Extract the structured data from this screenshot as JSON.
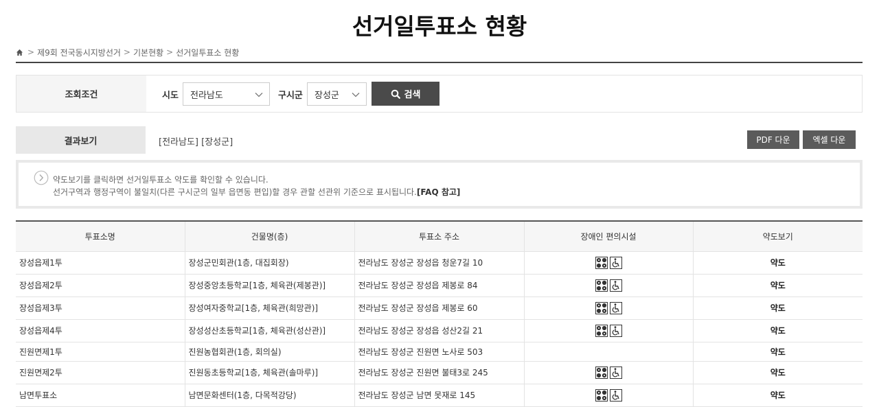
{
  "page_title": "선거일투표소 현황",
  "breadcrumb": {
    "home_icon": "home-icon",
    "items": [
      "제9회 전국동시지방선거",
      "기본현황",
      "선거일투표소 현황"
    ],
    "separator": ">"
  },
  "search": {
    "condition_label": "조회조건",
    "sido_label": "시도",
    "sido_value": "전라남도",
    "sigungu_label": "구시군",
    "sigungu_value": "장성군",
    "button_label": "검색"
  },
  "result": {
    "label": "결과보기",
    "text": "[전라남도] [장성군]",
    "pdf_button": "PDF 다운",
    "excel_button": "엑셀 다운"
  },
  "notice": {
    "line1": "약도보기를 클릭하면 선거일투표소 약도를 확인할 수 있습니다.",
    "line2": "선거구역과 행정구역이 불일치(다른 구시군의 일부 읍면동 편입)할 경우 관할 선관위 기준으로 표시됩니다.",
    "faq_link": "[FAQ 참고]"
  },
  "table": {
    "headers": [
      "투표소명",
      "건물명(층)",
      "투표소 주소",
      "장애인 편의시설",
      "약도보기"
    ],
    "rows": [
      {
        "name": "장성읍제1투",
        "building": "장성군민회관(1층, 대집회장)",
        "address": "전라남도 장성군 장성읍 청운7길 10",
        "facility": true,
        "map": "약도"
      },
      {
        "name": "장성읍제2투",
        "building": "장성중앙초등학교[1층, 체육관(제봉관)]",
        "address": "전라남도 장성군 장성읍 제봉로 84",
        "facility": true,
        "map": "약도"
      },
      {
        "name": "장성읍제3투",
        "building": "장성여자중학교[1층, 체육관(희망관)]",
        "address": "전라남도 장성군 장성읍 제봉로 60",
        "facility": true,
        "map": "약도"
      },
      {
        "name": "장성읍제4투",
        "building": "장성성산초등학교[1층, 체육관(성산관)]",
        "address": "전라남도 장성군 장성읍 성산2길 21",
        "facility": true,
        "map": "약도"
      },
      {
        "name": "진원면제1투",
        "building": "진원농협회관(1층, 회의실)",
        "address": "전라남도 장성군 진원면 노사로 503",
        "facility": false,
        "map": "약도"
      },
      {
        "name": "진원면제2투",
        "building": "진원동초등학교[1층, 체육관(솔마루)]",
        "address": "전라남도 장성군 진원면 불태3로 245",
        "facility": true,
        "map": "약도"
      },
      {
        "name": "남면투표소",
        "building": "남면문화센터(1층, 다목적강당)",
        "address": "전라남도 장성군 남면 못재로 145",
        "facility": true,
        "map": "약도"
      }
    ],
    "facility_icons": [
      "accessible-entrance-icon",
      "wheelchair-icon"
    ]
  }
}
